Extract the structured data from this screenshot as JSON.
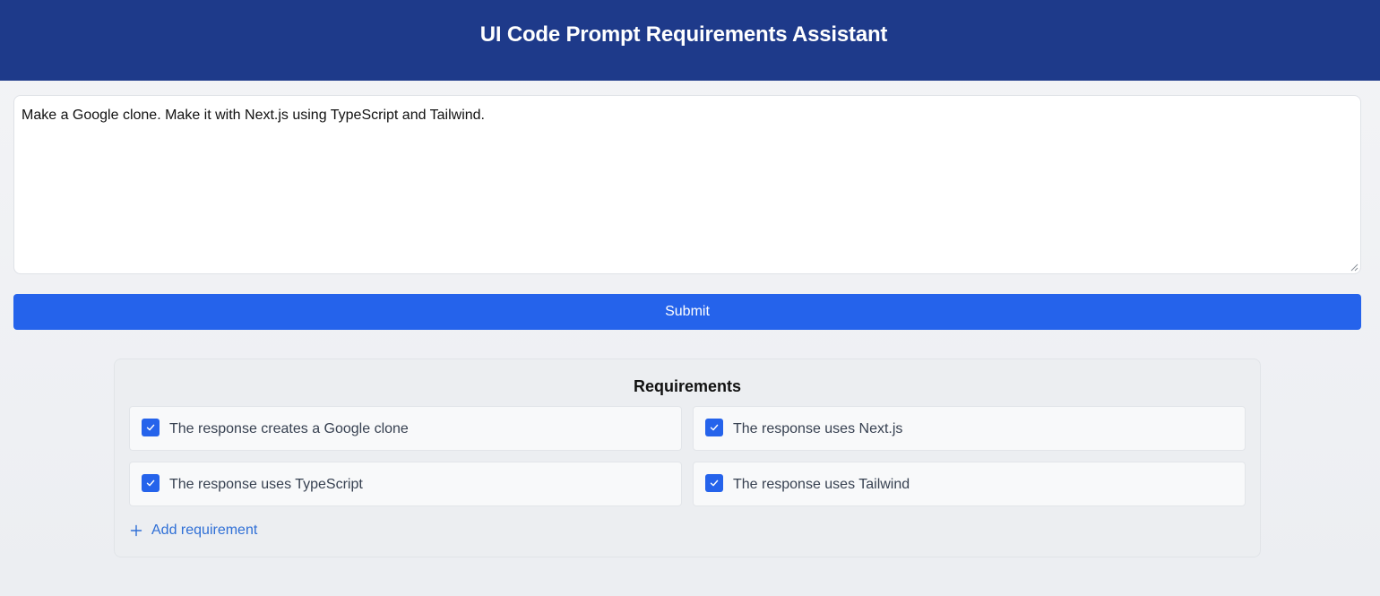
{
  "header": {
    "title": "UI Code Prompt Requirements Assistant"
  },
  "prompt": {
    "value": "Make a Google clone. Make it with Next.js using TypeScript and Tailwind.",
    "resize_icon": "resize-handle-icon"
  },
  "submit": {
    "label": "Submit"
  },
  "requirements": {
    "heading": "Requirements",
    "items": [
      {
        "label": "The response creates a Google clone",
        "checked": true
      },
      {
        "label": "The response uses Next.js",
        "checked": true
      },
      {
        "label": "The response uses TypeScript",
        "checked": true
      },
      {
        "label": "The response uses Tailwind",
        "checked": true
      }
    ],
    "add_label": "Add requirement",
    "add_icon": "plus-icon",
    "check_icon": "checkmark-icon"
  },
  "colors": {
    "header_bg": "#1e3a8a",
    "accent": "#2563eb",
    "link": "#2f6fd6"
  }
}
